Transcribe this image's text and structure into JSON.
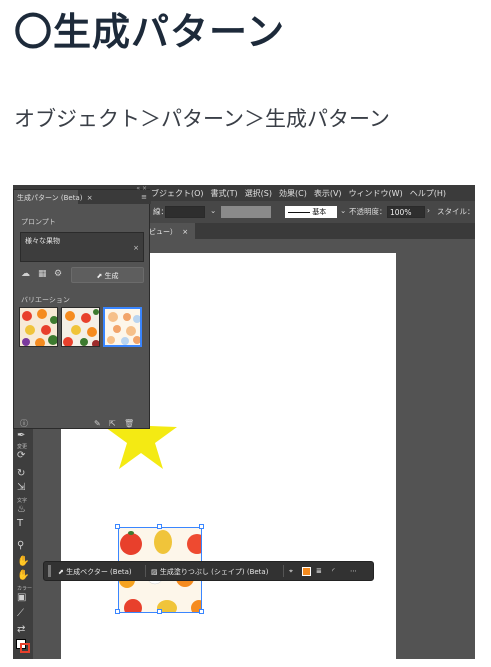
{
  "heading": "〇生成パターン",
  "breadcrumb": "オブジェクト＞パターン＞生成パターン",
  "app": {
    "menubar": [
      "ブジェクト(O)",
      "書式(T)",
      "選択(S)",
      "効果(C)",
      "表示(V)",
      "ウィンドウ(W)",
      "ヘルプ(H)"
    ],
    "controlbar": {
      "stroke_label": "線：",
      "stroke_style": "基本",
      "opacity_label": "不透明度：",
      "opacity_value": "100%",
      "style_label": "スタイル："
    },
    "doc_tab": "ビュー）",
    "tools": {
      "change_caption": "変更",
      "text_caption": "文字",
      "color_caption": "カラー"
    }
  },
  "panel": {
    "title": "生成パターン (Beta)",
    "prompt_label": "プロンプト",
    "prompt_value": "様々な果物",
    "generate_label": "生成",
    "variations_label": "バリエーション"
  },
  "taskbar": {
    "generate_vector_label": "生成ベクター (Beta)",
    "generative_shape_fill_label": "生成塗りつぶし (シェイプ) (Beta)"
  },
  "colors": {
    "heading": "#1d2a3a",
    "selection": "#3a86ff",
    "star": "#f4ea13",
    "ui_dark": "#535353"
  }
}
